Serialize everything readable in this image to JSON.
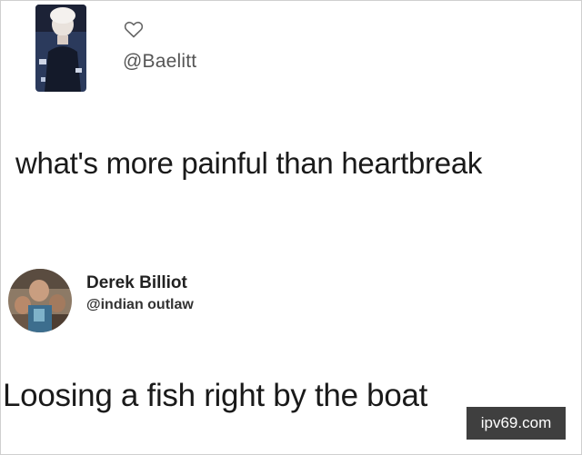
{
  "post1": {
    "avatar": "profile-photo-avatar",
    "like_icon": "heart-icon",
    "handle": "@Baelitt",
    "text": "what's more painful than heartbreak"
  },
  "post2": {
    "avatar": "profile-photo-avatar",
    "name": "Derek Billiot",
    "handle": "@indian outlaw",
    "text": "Loosing a fish right by the boat"
  },
  "watermark": {
    "text": "ipv69.com"
  }
}
